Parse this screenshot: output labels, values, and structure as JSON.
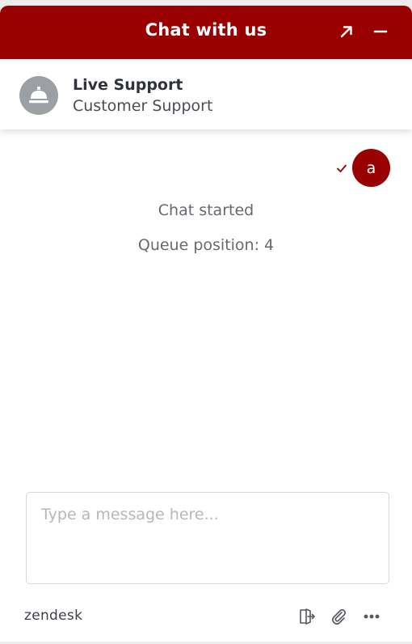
{
  "header": {
    "title": "Chat with us",
    "popout_icon": "arrow-up-right-icon",
    "minimize_icon": "minus-icon",
    "bg_color": "#990000"
  },
  "agent": {
    "name": "Live Support",
    "role": "Customer Support",
    "avatar_icon": "concierge-bell-icon"
  },
  "chat": {
    "user_initial": "a",
    "sent_status_icon": "check-icon",
    "messages": [
      "Chat started",
      "Queue position: 4"
    ]
  },
  "composer": {
    "placeholder": "Type a message here...",
    "value": ""
  },
  "footer": {
    "brand": "zendesk",
    "actions": [
      "end-chat-icon",
      "paperclip-icon",
      "more-icon"
    ]
  }
}
